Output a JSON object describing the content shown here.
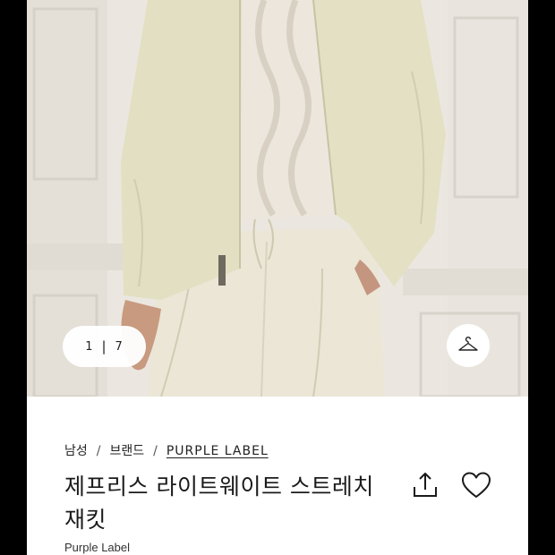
{
  "gallery": {
    "current": "1",
    "separator": "|",
    "total": "7",
    "hanger_icon": "hanger-icon"
  },
  "breadcrumb": {
    "items": [
      "남성",
      "브랜드",
      "PURPLE LABEL"
    ],
    "separator": "/"
  },
  "product": {
    "title": "제프리스 라이트웨이트 스트레치 재킷",
    "brand": "Purple Label"
  },
  "actions": {
    "share_icon": "share-icon",
    "wishlist_icon": "heart-icon"
  },
  "colors": {
    "background": "#ffffff",
    "letterbox": "#000000",
    "jacket": "#e6e2c6",
    "wall": "#ece8e1"
  }
}
